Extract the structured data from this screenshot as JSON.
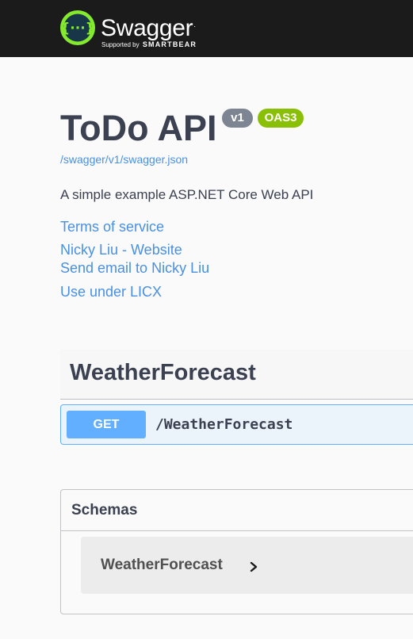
{
  "topbar": {
    "brand": "Swagger",
    "tagline_prefix": "Supported by",
    "tagline_vendor": "SMARTBEAR",
    "logo_icon": "swagger-braces-icon",
    "logo_color": "#85ea2d"
  },
  "info": {
    "title": "ToDo API",
    "version": "v1",
    "oas_badge": "OAS3",
    "spec_url": "/swagger/v1/swagger.json",
    "description": "A simple example ASP.NET Core Web API",
    "links": {
      "terms": "Terms of service",
      "website": "Nicky Liu - Website",
      "email": "Send email to Nicky Liu",
      "license": "Use under LICX"
    }
  },
  "operations": {
    "tag": "WeatherForecast",
    "items": [
      {
        "method": "GET",
        "path": "/WeatherForecast",
        "color": "#61affe"
      }
    ]
  },
  "schemas": {
    "title": "Schemas",
    "models": [
      {
        "name": "WeatherForecast",
        "toggle_icon": "chevron-right-icon"
      }
    ]
  },
  "colors": {
    "topbar_bg": "#1b1b1b",
    "link": "#4990e2",
    "version_badge": "#7d8492",
    "oas_badge": "#89bf04",
    "get_method": "#61affe"
  }
}
